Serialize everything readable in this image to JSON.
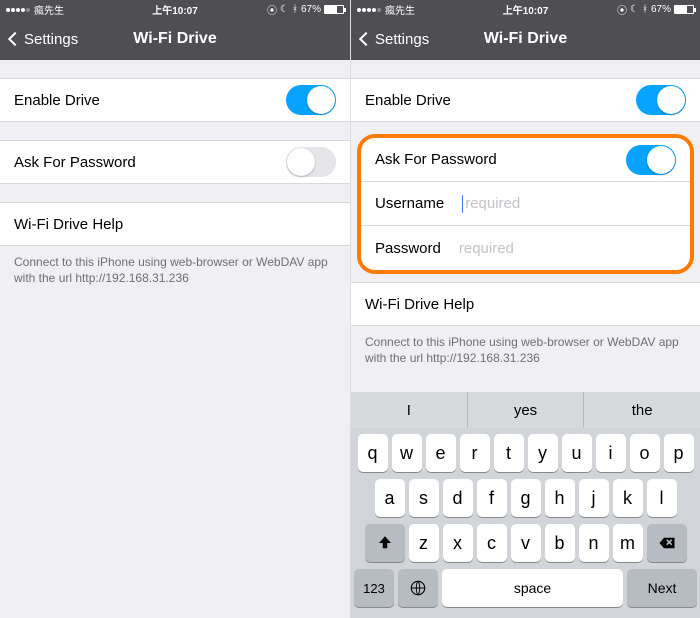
{
  "status": {
    "carrier": "瘋先生",
    "time": "上午10:07",
    "battery": "67%"
  },
  "nav": {
    "back": "Settings",
    "title": "Wi-Fi Drive"
  },
  "rows": {
    "enable": "Enable Drive",
    "askpw": "Ask For Password",
    "username": "Username",
    "password": "Password",
    "placeholder": "required",
    "help": "Wi-Fi Drive Help"
  },
  "footer": "Connect to this iPhone using web-browser or WebDAV app with the url http://192.168.31.236",
  "suggestions": [
    "I",
    "yes",
    "the"
  ],
  "keys": {
    "r1": [
      "q",
      "w",
      "e",
      "r",
      "t",
      "y",
      "u",
      "i",
      "o",
      "p"
    ],
    "r2": [
      "a",
      "s",
      "d",
      "f",
      "g",
      "h",
      "j",
      "k",
      "l"
    ],
    "r3": [
      "z",
      "x",
      "c",
      "v",
      "b",
      "n",
      "m"
    ],
    "nums": "123",
    "space": "space",
    "next": "Next"
  }
}
